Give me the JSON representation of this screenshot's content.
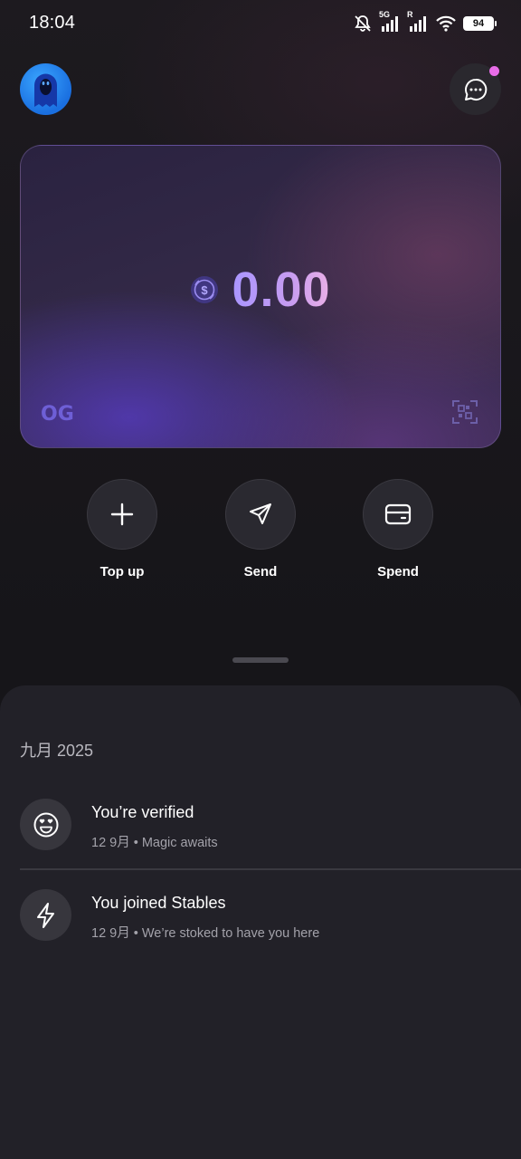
{
  "status_bar": {
    "time": "18:04",
    "network_5g": "5G",
    "roaming": "R",
    "battery": "94",
    "icons": [
      "mute-icon",
      "signal-5g-icon",
      "signal-r-icon",
      "wifi-icon",
      "battery-icon"
    ]
  },
  "header": {
    "avatar": "ghost-avatar",
    "chat_icon": "chat-bubble-icon",
    "notification_color": "#e86ce8"
  },
  "card": {
    "currency_icon": "usd-coin-icon",
    "balance": "0.00",
    "logo": "OG",
    "scan_icon": "qr-scan-icon"
  },
  "actions": [
    {
      "label": "Top up",
      "icon": "plus-icon"
    },
    {
      "label": "Send",
      "icon": "paper-plane-icon"
    },
    {
      "label": "Spend",
      "icon": "wallet-icon"
    }
  ],
  "activity": {
    "month": "九月 2025",
    "items": [
      {
        "title": "You’re verified",
        "subtitle": "12 9月 • Magic awaits",
        "icon": "smiley-heart-eyes-icon"
      },
      {
        "title": "You joined Stables",
        "subtitle": "12 9月 • We’re stoked to have you here",
        "icon": "lightning-icon"
      }
    ]
  },
  "colors": {
    "background": "#161519",
    "sheet": "#222128",
    "accent_purple": "#a996ff",
    "accent_pink": "#eab0e6"
  }
}
